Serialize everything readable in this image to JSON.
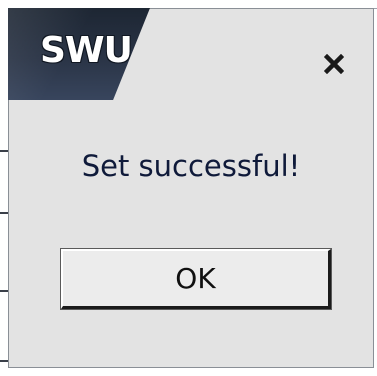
{
  "dialog": {
    "logo_text": "SWU",
    "close_icon": "close-icon",
    "message": "Set successful!",
    "ok_label": "OK"
  },
  "colors": {
    "dialog_bg": "#e3e3e3",
    "logo_bg": "#2a3446",
    "message_text": "#0f1a3a"
  }
}
